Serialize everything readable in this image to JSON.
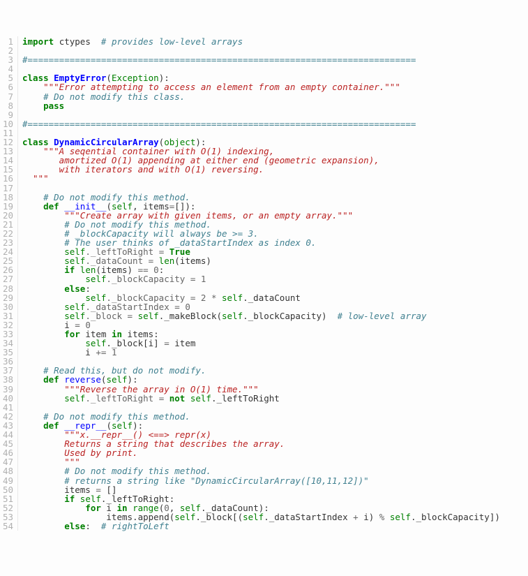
{
  "lines": [
    [
      [
        "import ",
        "kw"
      ],
      [
        "ctypes",
        ""
      ],
      [
        "  ",
        ""
      ],
      [
        "# provides low-level arrays",
        "cm"
      ]
    ],
    [],
    [
      [
        "#==========================================================================",
        "cm"
      ]
    ],
    [],
    [
      [
        "class ",
        "kw"
      ],
      [
        "EmptyError",
        "cls"
      ],
      [
        "(",
        "pun"
      ],
      [
        "Exception",
        "bi"
      ],
      [
        "):",
        "pun"
      ]
    ],
    [
      [
        "    ",
        ""
      ],
      [
        "\"\"\"Error attempting to access an element from an empty container.\"\"\"",
        "ds"
      ]
    ],
    [
      [
        "    ",
        ""
      ],
      [
        "# Do not modify this class.",
        "cm"
      ]
    ],
    [
      [
        "    ",
        ""
      ],
      [
        "pass",
        "kw"
      ]
    ],
    [],
    [
      [
        "#==========================================================================",
        "cm"
      ]
    ],
    [],
    [
      [
        "class ",
        "kw"
      ],
      [
        "DynamicCircularArray",
        "cls"
      ],
      [
        "(",
        "pun"
      ],
      [
        "object",
        "bi"
      ],
      [
        "):",
        "pun"
      ]
    ],
    [
      [
        "    ",
        ""
      ],
      [
        "\"\"\"A seqential container with O(1) indexing,",
        "ds"
      ]
    ],
    [
      [
        "       amortized O(1) appending at either end (geometric expansion),",
        "ds"
      ]
    ],
    [
      [
        "       with iterators and with O(1) reversing.",
        "ds"
      ]
    ],
    [
      [
        "  \"\"\"",
        "ds"
      ]
    ],
    [],
    [
      [
        "    ",
        ""
      ],
      [
        "# Do not modify this method.",
        "cm"
      ]
    ],
    [
      [
        "    ",
        ""
      ],
      [
        "def ",
        "kw"
      ],
      [
        "__init__",
        "fn"
      ],
      [
        "(",
        "pun"
      ],
      [
        "self",
        "slf"
      ],
      [
        ", items",
        "pun"
      ],
      [
        "=",
        "op"
      ],
      [
        "[]):",
        "pun"
      ]
    ],
    [
      [
        "        ",
        ""
      ],
      [
        "\"\"\"Create array with given items, or an empty array.\"\"\"",
        "ds"
      ]
    ],
    [
      [
        "        ",
        ""
      ],
      [
        "# Do not modify this method.",
        "cm"
      ]
    ],
    [
      [
        "        ",
        ""
      ],
      [
        "# _blockCapacity will always be >= 3.",
        "cm"
      ]
    ],
    [
      [
        "        ",
        ""
      ],
      [
        "# The user thinks of _dataStartIndex as index 0.",
        "cm"
      ]
    ],
    [
      [
        "        ",
        ""
      ],
      [
        "self",
        "slf"
      ],
      [
        "._leftToRight ",
        "op"
      ],
      [
        "= ",
        "op"
      ],
      [
        "True",
        "bool"
      ]
    ],
    [
      [
        "        ",
        ""
      ],
      [
        "self",
        "slf"
      ],
      [
        "._dataCount ",
        "op"
      ],
      [
        "= ",
        "op"
      ],
      [
        "len",
        "bi"
      ],
      [
        "(items)",
        "pun"
      ]
    ],
    [
      [
        "        ",
        ""
      ],
      [
        "if ",
        "kw"
      ],
      [
        "len",
        "bi"
      ],
      [
        "(items) ",
        "pun"
      ],
      [
        "== ",
        "op"
      ],
      [
        "0",
        "num"
      ],
      [
        ":",
        "pun"
      ]
    ],
    [
      [
        "            ",
        ""
      ],
      [
        "self",
        "slf"
      ],
      [
        "._blockCapacity ",
        "op"
      ],
      [
        "= ",
        "op"
      ],
      [
        "1",
        "num"
      ]
    ],
    [
      [
        "        ",
        ""
      ],
      [
        "else",
        "kw"
      ],
      [
        ":",
        "pun"
      ]
    ],
    [
      [
        "            ",
        ""
      ],
      [
        "self",
        "slf"
      ],
      [
        "._blockCapacity ",
        "op"
      ],
      [
        "= ",
        "op"
      ],
      [
        "2",
        "num"
      ],
      [
        " * ",
        "op"
      ],
      [
        "self",
        "slf"
      ],
      [
        "._dataCount",
        "att"
      ]
    ],
    [
      [
        "        ",
        ""
      ],
      [
        "self",
        "slf"
      ],
      [
        "._dataStartIndex ",
        "op"
      ],
      [
        "= ",
        "op"
      ],
      [
        "0",
        "num"
      ]
    ],
    [
      [
        "        ",
        ""
      ],
      [
        "self",
        "slf"
      ],
      [
        "._block ",
        "op"
      ],
      [
        "= ",
        "op"
      ],
      [
        "self",
        "slf"
      ],
      [
        "._makeBlock(",
        "att"
      ],
      [
        "self",
        "slf"
      ],
      [
        "._blockCapacity)  ",
        "att"
      ],
      [
        "# low-level array",
        "cm"
      ]
    ],
    [
      [
        "        i ",
        ""
      ],
      [
        "= ",
        "op"
      ],
      [
        "0",
        "num"
      ]
    ],
    [
      [
        "        ",
        ""
      ],
      [
        "for ",
        "kw"
      ],
      [
        "item ",
        ""
      ],
      [
        "in ",
        "kw"
      ],
      [
        "items:",
        "pun"
      ]
    ],
    [
      [
        "            ",
        ""
      ],
      [
        "self",
        "slf"
      ],
      [
        "._block[i] ",
        "att"
      ],
      [
        "= ",
        "op"
      ],
      [
        "item",
        ""
      ]
    ],
    [
      [
        "            i ",
        ""
      ],
      [
        "+= ",
        "op"
      ],
      [
        "1",
        "num"
      ]
    ],
    [],
    [
      [
        "    ",
        ""
      ],
      [
        "# Read this, but do not modify.",
        "cm"
      ]
    ],
    [
      [
        "    ",
        ""
      ],
      [
        "def ",
        "kw"
      ],
      [
        "reverse",
        "fn"
      ],
      [
        "(",
        "pun"
      ],
      [
        "self",
        "slf"
      ],
      [
        "):",
        "pun"
      ]
    ],
    [
      [
        "        ",
        ""
      ],
      [
        "\"\"\"Reverse the array in O(1) time.\"\"\"",
        "ds"
      ]
    ],
    [
      [
        "        ",
        ""
      ],
      [
        "self",
        "slf"
      ],
      [
        "._leftToRight ",
        "op"
      ],
      [
        "= ",
        "op"
      ],
      [
        "not ",
        "kw"
      ],
      [
        "self",
        "slf"
      ],
      [
        "._leftToRight",
        "att"
      ]
    ],
    [],
    [
      [
        "    ",
        ""
      ],
      [
        "# Do not modify this method.",
        "cm"
      ]
    ],
    [
      [
        "    ",
        ""
      ],
      [
        "def ",
        "kw"
      ],
      [
        "__repr__",
        "fn"
      ],
      [
        "(",
        "pun"
      ],
      [
        "self",
        "slf"
      ],
      [
        "):",
        "pun"
      ]
    ],
    [
      [
        "        ",
        ""
      ],
      [
        "\"\"\"x.__repr__() <==> repr(x)",
        "ds"
      ]
    ],
    [
      [
        "        Returns a string that describes the array.",
        "ds"
      ]
    ],
    [
      [
        "        Used by print.",
        "ds"
      ]
    ],
    [
      [
        "        \"\"\"",
        "ds"
      ]
    ],
    [
      [
        "        ",
        ""
      ],
      [
        "# Do not modify this method.",
        "cm"
      ]
    ],
    [
      [
        "        ",
        ""
      ],
      [
        "# returns a string like \"DynamicCircularArray([10,11,12])\"",
        "cm"
      ]
    ],
    [
      [
        "        items ",
        ""
      ],
      [
        "= ",
        "op"
      ],
      [
        "[]",
        "pun"
      ]
    ],
    [
      [
        "        ",
        ""
      ],
      [
        "if ",
        "kw"
      ],
      [
        "self",
        "slf"
      ],
      [
        "._leftToRight:",
        "att"
      ]
    ],
    [
      [
        "            ",
        ""
      ],
      [
        "for ",
        "kw"
      ],
      [
        "i ",
        ""
      ],
      [
        "in ",
        "kw"
      ],
      [
        "range",
        "bi"
      ],
      [
        "(",
        "pun"
      ],
      [
        "0",
        "num"
      ],
      [
        ", ",
        "pun"
      ],
      [
        "self",
        "slf"
      ],
      [
        "._dataCount):",
        "att"
      ]
    ],
    [
      [
        "                items.append(",
        ""
      ],
      [
        "self",
        "slf"
      ],
      [
        "._block[(",
        "att"
      ],
      [
        "self",
        "slf"
      ],
      [
        "._dataStartIndex ",
        "att"
      ],
      [
        "+ ",
        "op"
      ],
      [
        "i) ",
        ""
      ],
      [
        "% ",
        "op"
      ],
      [
        "self",
        "slf"
      ],
      [
        "._blockCapacity])",
        "att"
      ]
    ],
    [
      [
        "        ",
        ""
      ],
      [
        "else",
        "kw"
      ],
      [
        ":  ",
        "pun"
      ],
      [
        "# rightToLeft",
        "cm"
      ]
    ]
  ],
  "line_count": 54
}
